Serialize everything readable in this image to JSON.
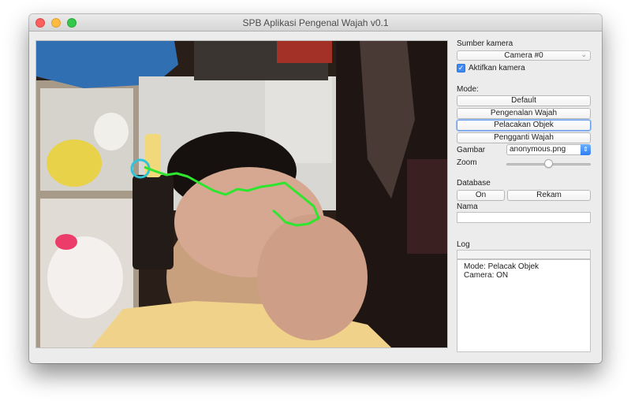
{
  "window": {
    "title": "SPB Aplikasi Pengenal Wajah v0.1"
  },
  "panel": {
    "camera_source_label": "Sumber kamera",
    "camera_select_value": "Camera #0",
    "enable_camera_label": "Aktifkan kamera",
    "enable_camera_checked": true,
    "mode_label": "Mode:",
    "mode_buttons": [
      "Default",
      "Pengenalan Wajah",
      "Pelacakan Objek",
      "Pengganti Wajah"
    ],
    "active_mode": "Pelacakan Objek",
    "image_label": "Gambar",
    "image_value": "anonymous.png",
    "zoom_label": "Zoom",
    "zoom_level": 0.5,
    "database_label": "Database",
    "db_on_label": "On",
    "db_record_label": "Rekam",
    "name_label": "Nama",
    "name_value": "",
    "log_label": "Log",
    "log_lines": [
      "Mode: Pelacak Objek",
      "Camera: ON"
    ]
  },
  "colors": {
    "accent": "#3f8bf3",
    "tracking_path": "#2ee62e",
    "tracking_circle": "#31c4d8"
  },
  "icons": {
    "checkbox": "checkmark-icon",
    "camera_select": "chevron-down-icon",
    "image_combo": "up-down-arrows-icon"
  }
}
